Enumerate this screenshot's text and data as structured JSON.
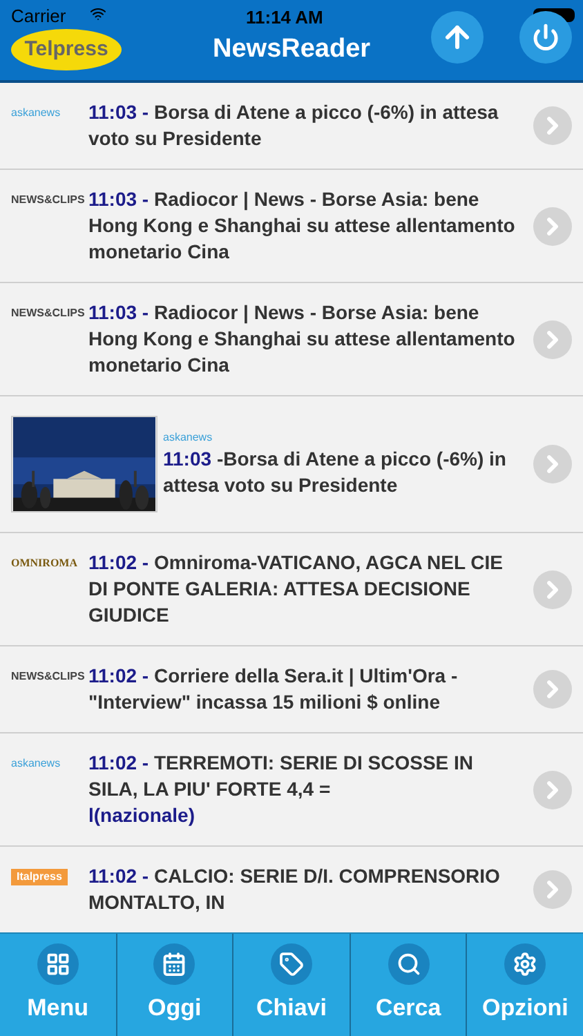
{
  "status_bar": {
    "carrier": "Carrier",
    "time": "11:14 AM"
  },
  "header": {
    "logo": "Telpress",
    "title": "NewsReader"
  },
  "news": [
    {
      "kind": "logo",
      "source": "askanews",
      "time": "11:03 -",
      "title": "Borsa di Atene a picco (-6%) in attesa voto su Presidente"
    },
    {
      "kind": "logo",
      "source": "NEWS&CLIPS",
      "time": "11:03 -",
      "title": "Radiocor | News - Borse Asia: bene Hong Kong e Shanghai su attese allentamento monetario Cina"
    },
    {
      "kind": "logo",
      "source": "NEWS&CLIPS",
      "time": "11:03 -",
      "title": "Radiocor | News - Borse Asia: bene Hong Kong e Shanghai su attese allentamento monetario Cina"
    },
    {
      "kind": "picture",
      "source": "askanews",
      "time": "11:03",
      "title": "-Borsa di Atene a picco (-6%) in attesa voto su Presidente"
    },
    {
      "kind": "logo",
      "source": "OMNIROMA",
      "time": "11:02 -",
      "title": "Omniroma-VATICANO, AGCA NEL CIE DI PONTE GALERIA: ATTESA DECISIONE GIUDICE"
    },
    {
      "kind": "logo",
      "source": "NEWS&CLIPS",
      "time": "11:02 -",
      "title": "Corriere della Sera.it | Ultim'Ora - \"Interview\" incassa 15 milioni $ online"
    },
    {
      "kind": "logo",
      "source": "askanews",
      "time": "11:02 -",
      "title": "TERREMOTI: SERIE DI SCOSSE IN SILA, LA PIU' FORTE 4,4 =",
      "tail": "l(nazionale)"
    },
    {
      "kind": "logo",
      "source": "Italpress",
      "time": "11:02 -",
      "title": "CALCIO: SERIE D/I. COMPRENSORIO MONTALTO, IN"
    }
  ],
  "tabs": [
    {
      "kind": "grid",
      "label": "Menu"
    },
    {
      "kind": "calendar",
      "label": "Oggi"
    },
    {
      "kind": "tag",
      "label": "Chiavi"
    },
    {
      "kind": "search",
      "label": "Cerca"
    },
    {
      "kind": "gear",
      "label": "Opzioni"
    }
  ]
}
